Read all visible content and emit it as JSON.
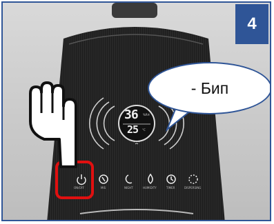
{
  "step": {
    "number": "4"
  },
  "callout": {
    "text": "- Бип"
  },
  "display": {
    "humidity": "36",
    "humidity_unit": "%RH",
    "temperature": "25",
    "temperature_unit": "°C"
  },
  "controls": [
    {
      "icon": "power-icon",
      "label": "ON/OFF"
    },
    {
      "icon": "mist-icon",
      "label": "MIS"
    },
    {
      "icon": "moon-icon",
      "label": "NIGHT"
    },
    {
      "icon": "drop-icon",
      "label": "HUMIDITY"
    },
    {
      "icon": "clock-icon",
      "label": "TIMER"
    },
    {
      "icon": "dashed-circle-icon",
      "label": "DISPERSING"
    }
  ],
  "colors": {
    "badge": "#2f5597",
    "highlight": "#e01010",
    "device": "#1c1c1c"
  }
}
